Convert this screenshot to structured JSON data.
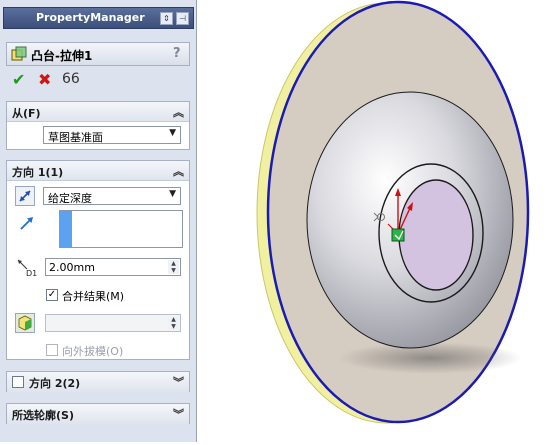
{
  "pm": {
    "header_title": "PropertyManager",
    "feature_title": "凸台-拉伸1",
    "help": "?",
    "ok": "✔",
    "cancel": "✖",
    "preview": "66"
  },
  "from": {
    "label": "从(F)",
    "option": "草图基准面"
  },
  "direction1": {
    "label": "方向 1(1)",
    "end_condition": "给定深度",
    "depth": "2.00mm",
    "depth_icon_label": "D1",
    "merge_label": "合并结果(M)",
    "merge_checked": true,
    "draft_outward_label": "向外拔模(O)",
    "draft_checked": false
  },
  "direction2": {
    "label": "方向 2(2)",
    "checked": false
  },
  "selected_contours": {
    "label": "所选轮廓(S)"
  },
  "colors": {
    "accent": "#5ba3f0",
    "header": "#3c4f7b",
    "disc_face": "#d6cdc2",
    "disc_edge": "#1a1ab4",
    "disc_rim": "#f1f0a0",
    "boss": "#d3c3e0",
    "ok": "#1e9a1e",
    "cancel": "#d21414"
  }
}
